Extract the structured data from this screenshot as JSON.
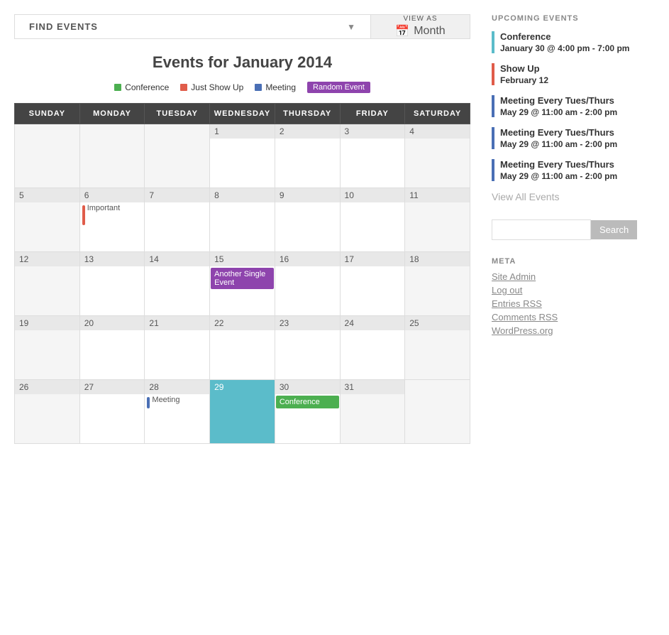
{
  "findEvents": {
    "label": "FIND EVENTS",
    "arrow": "▼"
  },
  "viewAs": {
    "label": "VIEW AS",
    "mode": "Month",
    "icon": "📅"
  },
  "calendar": {
    "title": "Events for January 2014",
    "days": [
      "SUNDAY",
      "MONDAY",
      "TUESDAY",
      "WEDNESDAY",
      "THURSDAY",
      "FRIDAY",
      "SATURDAY"
    ],
    "legend": [
      {
        "label": "Conference",
        "color": "#4caf50",
        "type": "dot"
      },
      {
        "label": "Just Show Up",
        "color": "#e05c4a",
        "type": "dot"
      },
      {
        "label": "Meeting",
        "color": "#4a6fb5",
        "type": "dot"
      },
      {
        "label": "Random Event",
        "color": "#8e44ad",
        "type": "badge"
      }
    ]
  },
  "sidebar": {
    "upcomingTitle": "UPCOMING EVENTS",
    "events": [
      {
        "title": "Conference",
        "date": "January 30 @ 4:00 pm - 7:00 pm",
        "color": "teal"
      },
      {
        "title": "Show Up",
        "date": "February 12",
        "color": "red"
      },
      {
        "title": "Meeting Every Tues/Thurs",
        "date": "May 29 @ 11:00 am - 2:00 pm",
        "color": "blue"
      },
      {
        "title": "Meeting Every Tues/Thurs",
        "date": "May 29 @ 11:00 am - 2:00 pm",
        "color": "blue"
      },
      {
        "title": "Meeting Every Tues/Thurs",
        "date": "May 29 @ 11:00 am - 2:00 pm",
        "color": "blue"
      }
    ],
    "viewAllLabel": "View All Events",
    "search": {
      "placeholder": "",
      "buttonLabel": "Search"
    },
    "metaTitle": "META",
    "metaLinks": [
      "Site Admin",
      "Log out",
      "Entries RSS",
      "Comments RSS",
      "WordPress.org"
    ]
  }
}
